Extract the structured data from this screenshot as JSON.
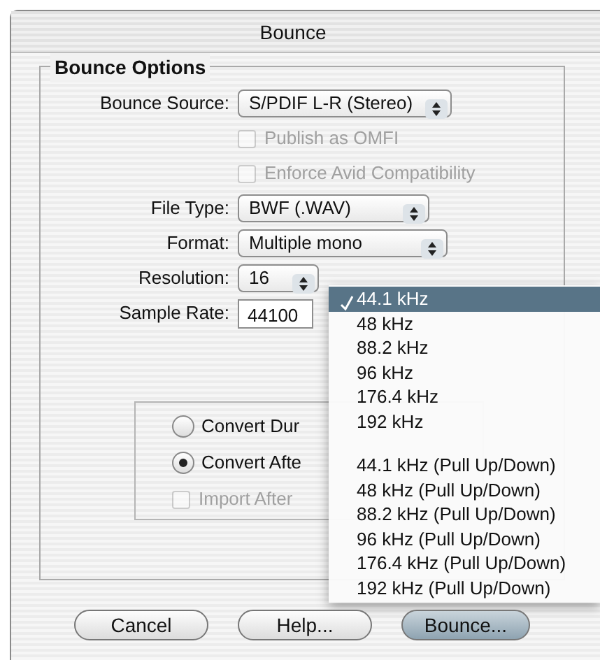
{
  "window": {
    "title": "Bounce"
  },
  "group": {
    "title": "Bounce Options"
  },
  "fields": [
    {
      "kind": "popup",
      "label": "Bounce Source:",
      "value": "S/PDIF L-R (Stereo)"
    },
    {
      "kind": "checkbox",
      "label": "Publish as OMFI",
      "checked": false,
      "disabled": true
    },
    {
      "kind": "checkbox",
      "label": "Enforce Avid Compatibility",
      "checked": false,
      "disabled": true
    },
    {
      "kind": "popup",
      "label": "File Type:",
      "value": "BWF (.WAV)"
    },
    {
      "kind": "popup",
      "label": "Format:",
      "value": "Multiple mono"
    },
    {
      "kind": "popup",
      "label": "Resolution:",
      "value": "16"
    },
    {
      "kind": "text",
      "label": "Sample Rate:",
      "value": "44100"
    }
  ],
  "conversion": [
    {
      "kind": "radio",
      "label": "Convert Dur",
      "selected": false
    },
    {
      "kind": "radio",
      "label": "Convert Afte",
      "selected": true
    },
    {
      "kind": "checkbox",
      "label": "Import After",
      "checked": false,
      "disabled": true
    }
  ],
  "menu": {
    "groups": [
      [
        {
          "label": "44.1 kHz",
          "selected": true,
          "checked": true
        },
        {
          "label": "48 kHz",
          "selected": false,
          "checked": false
        },
        {
          "label": "88.2 kHz",
          "selected": false,
          "checked": false
        },
        {
          "label": "96 kHz",
          "selected": false,
          "checked": false
        },
        {
          "label": "176.4 kHz",
          "selected": false,
          "checked": false
        },
        {
          "label": "192 kHz",
          "selected": false,
          "checked": false
        }
      ],
      [
        {
          "label": "44.1 kHz (Pull Up/Down)",
          "selected": false,
          "checked": false
        },
        {
          "label": "48 kHz (Pull Up/Down)",
          "selected": false,
          "checked": false
        },
        {
          "label": "88.2 kHz (Pull Up/Down)",
          "selected": false,
          "checked": false
        },
        {
          "label": "96 kHz (Pull Up/Down)",
          "selected": false,
          "checked": false
        },
        {
          "label": "176.4 kHz (Pull Up/Down)",
          "selected": false,
          "checked": false
        },
        {
          "label": "192 kHz (Pull Up/Down)",
          "selected": false,
          "checked": false
        }
      ]
    ]
  },
  "buttons": [
    {
      "label": "Cancel",
      "default": false
    },
    {
      "label": "Help...",
      "default": false
    },
    {
      "label": "Bounce...",
      "default": true
    }
  ]
}
